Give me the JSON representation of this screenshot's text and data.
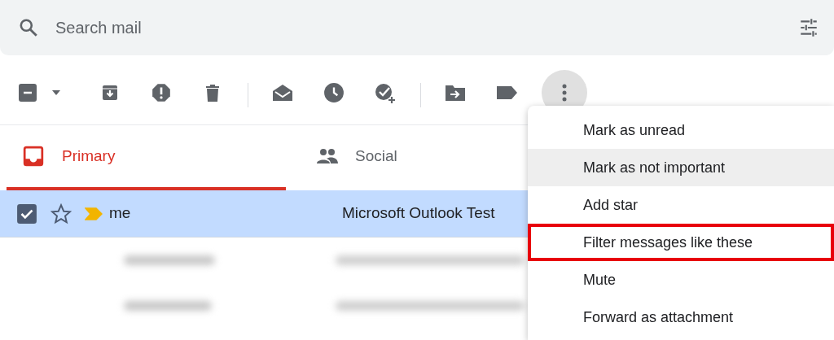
{
  "search": {
    "placeholder": "Search mail"
  },
  "toolbar": {
    "select_all": {
      "checked": false,
      "indeterminate": true
    },
    "more_open": true
  },
  "tabs": [
    {
      "label": "Primary",
      "selected": true,
      "kind": "inbox"
    },
    {
      "label": "Social",
      "selected": false,
      "kind": "people"
    }
  ],
  "rows": [
    {
      "sender": "me",
      "subject": "Microsoft Outlook Test",
      "selected": true,
      "checked": true,
      "starred": false,
      "important": true
    }
  ],
  "menu": {
    "items": [
      {
        "label": "Mark as unread",
        "hovered": false,
        "highlighted": false
      },
      {
        "label": "Mark as not important",
        "hovered": true,
        "highlighted": false
      },
      {
        "label": "Add star",
        "hovered": false,
        "highlighted": false
      },
      {
        "label": "Filter messages like these",
        "hovered": false,
        "highlighted": true
      },
      {
        "label": "Mute",
        "hovered": false,
        "highlighted": false
      },
      {
        "label": "Forward as attachment",
        "hovered": false,
        "highlighted": false
      }
    ]
  }
}
